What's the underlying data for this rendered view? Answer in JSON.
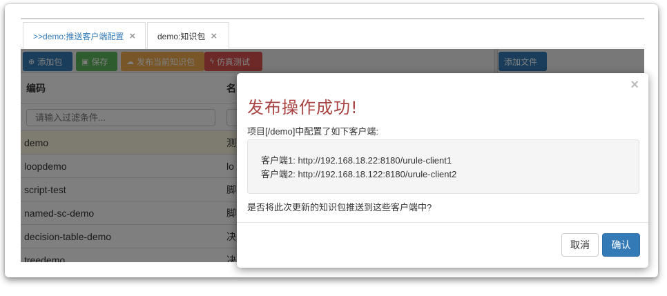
{
  "tabs": [
    {
      "label": ">>demo:推送客户端配置",
      "close": "×"
    },
    {
      "label": "demo:知识包",
      "close": "×"
    }
  ],
  "toolbar": {
    "add_label": "添加包",
    "save_label": "保存",
    "publish_label": "发布当前知识包",
    "simulate_label": "仿真测试",
    "add_file_label": "添加文件"
  },
  "grid": {
    "headers": [
      "编码",
      "名"
    ],
    "filter_placeholder": "请输入过滤条件...",
    "rows": [
      {
        "code": "demo",
        "name": "测"
      },
      {
        "code": "loopdemo",
        "name": "lo"
      },
      {
        "code": "script-test",
        "name": "脚"
      },
      {
        "code": "named-sc-demo",
        "name": "脚"
      },
      {
        "code": "decision-table-demo",
        "name": "决"
      },
      {
        "code": "treedemo",
        "name": "决"
      }
    ]
  },
  "modal": {
    "close": "×",
    "title": "发布操作成功!",
    "line1": "项目[/demo]中配置了如下客户端:",
    "clients": [
      "客户端1: http://192.168.18.22:8180/urule-client1",
      "客户端2: http://192.168.18.122:8180/urule-client2"
    ],
    "question": "是否将此次更新的知识包推送到这些客户端中?",
    "cancel_label": "取消",
    "ok_label": "确认"
  }
}
